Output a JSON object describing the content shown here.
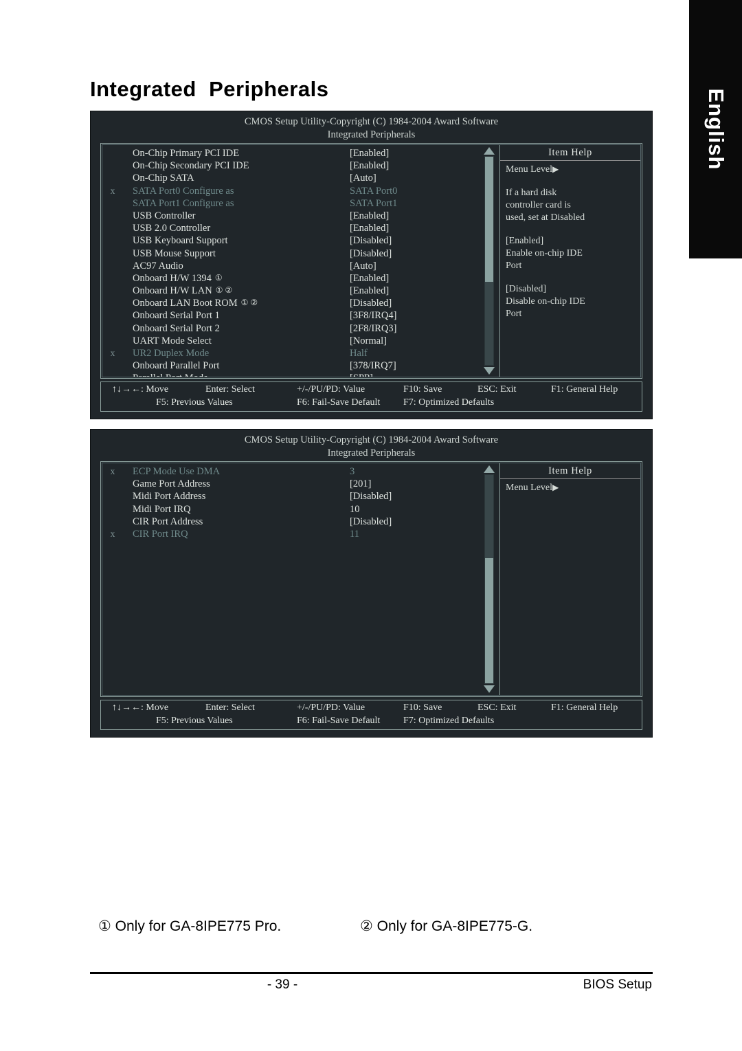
{
  "lang_tab": {
    "label": "English"
  },
  "page_title": "Integrated  Peripherals",
  "screen1": {
    "header_line1": "CMOS Setup Utility-Copyright (C) 1984-2004 Award Software",
    "header_line2": "Integrated Peripherals",
    "rows": [
      {
        "x": "",
        "label": "On-Chip Primary PCI IDE",
        "mark": "",
        "value": "[Enabled]",
        "dim": false
      },
      {
        "x": "",
        "label": "On-Chip Secondary PCI IDE",
        "mark": "",
        "value": "[Enabled]",
        "dim": false
      },
      {
        "x": "",
        "label": "On-Chip SATA",
        "mark": "",
        "value": "[Auto]",
        "dim": false
      },
      {
        "x": "x",
        "label": "SATA Port0 Configure as",
        "mark": "",
        "value": "SATA Port0",
        "dim": true
      },
      {
        "x": "",
        "label": "SATA Port1 Configure as",
        "mark": "",
        "value": "SATA Port1",
        "dim": true
      },
      {
        "x": "",
        "label": "USB Controller",
        "mark": "",
        "value": "[Enabled]",
        "dim": false
      },
      {
        "x": "",
        "label": "USB 2.0 Controller",
        "mark": "",
        "value": "[Enabled]",
        "dim": false
      },
      {
        "x": "",
        "label": "USB Keyboard Support",
        "mark": "",
        "value": "[Disabled]",
        "dim": false
      },
      {
        "x": "",
        "label": "USB Mouse Support",
        "mark": "",
        "value": "[Disabled]",
        "dim": false
      },
      {
        "x": "",
        "label": "AC97 Audio",
        "mark": "",
        "value": "[Auto]",
        "dim": false
      },
      {
        "x": "",
        "label": "Onboard H/W 1394",
        "mark": "①",
        "value": "[Enabled]",
        "dim": false
      },
      {
        "x": "",
        "label": "Onboard H/W LAN",
        "mark": "① ②",
        "value": "[Enabled]",
        "dim": false
      },
      {
        "x": "",
        "label": "Onboard LAN Boot ROM",
        "mark": "① ②",
        "value": "[Disabled]",
        "dim": false
      },
      {
        "x": "",
        "label": "Onboard Serial Port 1",
        "mark": "",
        "value": "[3F8/IRQ4]",
        "dim": false
      },
      {
        "x": "",
        "label": "Onboard Serial Port 2",
        "mark": "",
        "value": "[2F8/IRQ3]",
        "dim": false
      },
      {
        "x": "",
        "label": "UART Mode Select",
        "mark": "",
        "value": "[Normal]",
        "dim": false
      },
      {
        "x": "x",
        "label": "UR2 Duplex Mode",
        "mark": "",
        "value": "Half",
        "dim": true
      },
      {
        "x": "",
        "label": "Onboard Parallel Port",
        "mark": "",
        "value": "[378/IRQ7]",
        "dim": false
      },
      {
        "x": "",
        "label": "Parallel Port Mode",
        "mark": "",
        "value": "[SPP]",
        "dim": false
      }
    ],
    "scrollbar": {
      "thumb_top_pct": 0,
      "thumb_height_pct": 60
    },
    "help": {
      "title": "Item Help",
      "menu_level": "Menu Level",
      "menu_level_arrow": "▶",
      "para1_line1": "If a hard disk",
      "para1_line2": "controller card is",
      "para1_line3": "used, set at Disabled",
      "para2_line1": "[Enabled]",
      "para2_line2": "Enable on-chip IDE",
      "para2_line3": "Port",
      "para3_line1": "[Disabled]",
      "para3_line2": "Disable on-chip IDE",
      "para3_line3": "Port"
    },
    "keys": {
      "move": "↑↓→←: Move",
      "select": "Enter: Select",
      "value": "+/-/PU/PD: Value",
      "save": "F10: Save",
      "exit": "ESC: Exit",
      "general_help": "F1: General Help",
      "previous": "F5: Previous Values",
      "failsave": "F6: Fail-Save Default",
      "optimized": "F7: Optimized Defaults"
    }
  },
  "screen2": {
    "header_line1": "CMOS Setup Utility-Copyright (C) 1984-2004 Award Software",
    "header_line2": "Integrated Peripherals",
    "rows": [
      {
        "x": "x",
        "label": "ECP Mode Use DMA",
        "mark": "",
        "value": "3",
        "dim": true
      },
      {
        "x": "",
        "label": "Game Port Address",
        "mark": "",
        "value": "[201]",
        "dim": false
      },
      {
        "x": "",
        "label": "Midi Port Address",
        "mark": "",
        "value": "[Disabled]",
        "dim": false
      },
      {
        "x": "",
        "label": "Midi Port IRQ",
        "mark": "",
        "value": "10",
        "dim": false
      },
      {
        "x": "",
        "label": "CIR Port Address",
        "mark": "",
        "value": "[Disabled]",
        "dim": false
      },
      {
        "x": "x",
        "label": "CIR Port IRQ",
        "mark": "",
        "value": "11",
        "dim": true
      }
    ],
    "scrollbar": {
      "thumb_top_pct": 40,
      "thumb_height_pct": 60
    },
    "help": {
      "title": "Item Help",
      "menu_level": "Menu Level",
      "menu_level_arrow": "▶"
    },
    "keys": {
      "move": "↑↓→←: Move",
      "select": "Enter: Select",
      "value": "+/-/PU/PD: Value",
      "save": "F10: Save",
      "exit": "ESC: Exit",
      "general_help": "F1: General Help",
      "previous": "F5: Previous Values",
      "failsave": "F6: Fail-Save Default",
      "optimized": "F7: Optimized Defaults"
    }
  },
  "footnotes": {
    "note1": "① Only for GA-8IPE775 Pro.",
    "note2": "② Only for GA-8IPE775-G."
  },
  "page_footer": {
    "page_number": "- 39 -",
    "section": "BIOS Setup"
  }
}
